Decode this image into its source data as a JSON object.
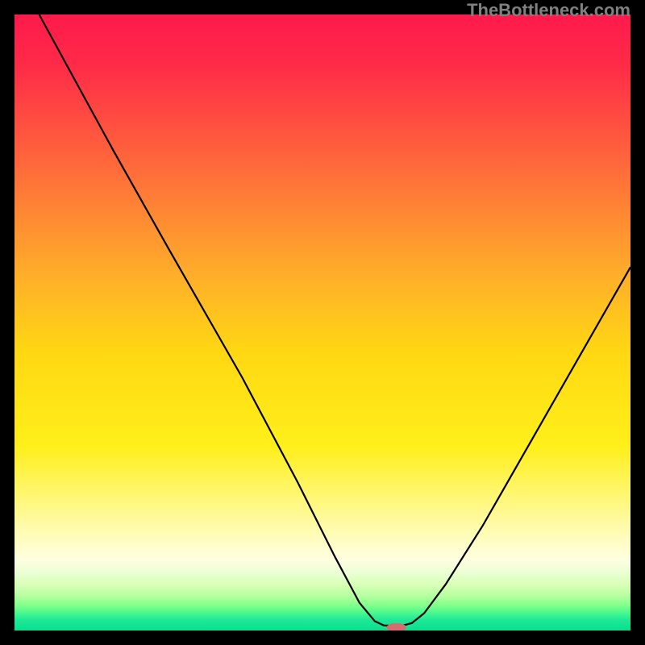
{
  "watermark": "TheBottleneck.com",
  "chart_data": {
    "type": "line",
    "title": "",
    "xlabel": "",
    "ylabel": "",
    "xlim": [
      0,
      100
    ],
    "ylim": [
      0,
      100
    ],
    "gradient_stops": [
      {
        "offset": 0.0,
        "color": "#ff1a4b"
      },
      {
        "offset": 0.08,
        "color": "#ff2a48"
      },
      {
        "offset": 0.25,
        "color": "#ff6b3a"
      },
      {
        "offset": 0.42,
        "color": "#ffad2a"
      },
      {
        "offset": 0.55,
        "color": "#ffd813"
      },
      {
        "offset": 0.7,
        "color": "#ffef1a"
      },
      {
        "offset": 0.84,
        "color": "#fffcb3"
      },
      {
        "offset": 0.885,
        "color": "#fffee0"
      },
      {
        "offset": 0.905,
        "color": "#ecffd5"
      },
      {
        "offset": 0.925,
        "color": "#d9ffb8"
      },
      {
        "offset": 0.945,
        "color": "#b3ff9e"
      },
      {
        "offset": 0.96,
        "color": "#7fff89"
      },
      {
        "offset": 0.972,
        "color": "#46f88f"
      },
      {
        "offset": 0.983,
        "color": "#1fe898"
      },
      {
        "offset": 1.0,
        "color": "#0adf8f"
      }
    ],
    "curve_points": [
      {
        "x": 4.0,
        "y": 100.0
      },
      {
        "x": 16.0,
        "y": 78.0
      },
      {
        "x": 25.0,
        "y": 62.0
      },
      {
        "x": 27.0,
        "y": 58.5
      },
      {
        "x": 37.0,
        "y": 41.0
      },
      {
        "x": 46.0,
        "y": 24.0
      },
      {
        "x": 52.0,
        "y": 12.0
      },
      {
        "x": 56.0,
        "y": 4.5
      },
      {
        "x": 58.5,
        "y": 1.5
      },
      {
        "x": 60.0,
        "y": 0.8
      },
      {
        "x": 63.0,
        "y": 0.8
      },
      {
        "x": 64.5,
        "y": 1.2
      },
      {
        "x": 66.5,
        "y": 2.8
      },
      {
        "x": 70.0,
        "y": 7.5
      },
      {
        "x": 76.0,
        "y": 17.0
      },
      {
        "x": 84.0,
        "y": 31.0
      },
      {
        "x": 92.0,
        "y": 45.0
      },
      {
        "x": 100.0,
        "y": 59.0
      }
    ],
    "marker": {
      "x": 62.0,
      "y": 0.5,
      "color": "#d96a6e",
      "rx": 1.6,
      "ry": 0.7
    }
  }
}
